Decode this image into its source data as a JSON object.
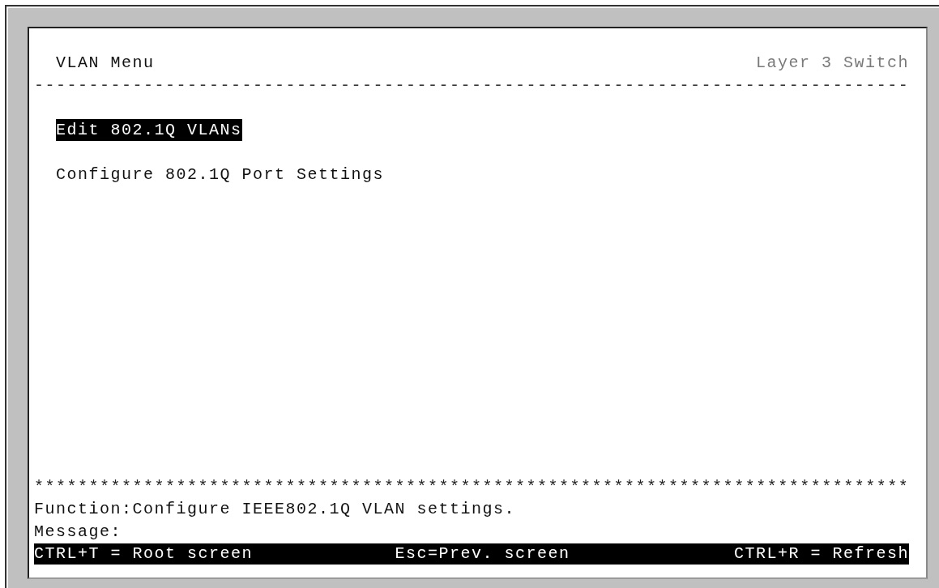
{
  "header": {
    "title": "VLAN Menu",
    "device": "Layer 3 Switch",
    "rule": "--------------------------------------------------------------------------------"
  },
  "menu": {
    "items": [
      {
        "label": "Edit 802.1Q VLANs",
        "selected": true
      },
      {
        "label": "Configure 802.1Q Port Settings",
        "selected": false
      }
    ]
  },
  "footer": {
    "rule": "********************************************************************************",
    "function": "Function:Configure IEEE802.1Q VLAN settings.",
    "message": "Message:"
  },
  "key_bar": [
    "CTRL+T = Root screen",
    "Esc=Prev. screen",
    "CTRL+R = Refresh"
  ]
}
